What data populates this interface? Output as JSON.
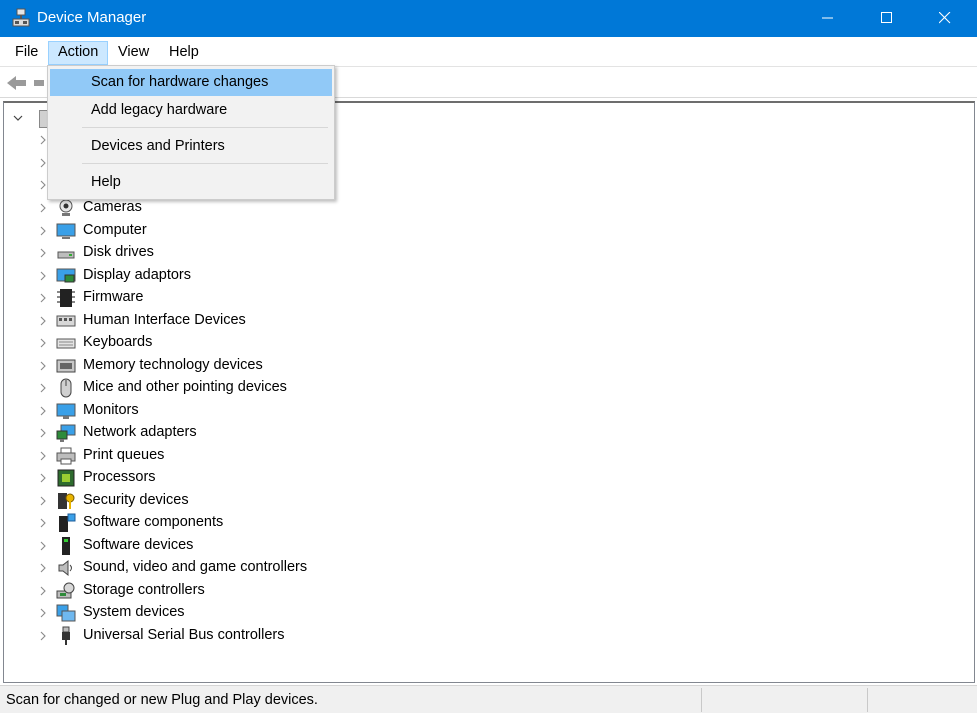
{
  "window": {
    "title": "Device Manager"
  },
  "menu": {
    "file": "File",
    "action": "Action",
    "view": "View",
    "help": "Help"
  },
  "action_menu": {
    "items": [
      {
        "label": "Scan for hardware changes",
        "highlighted": true
      },
      {
        "label": "Add legacy hardware"
      },
      {
        "label": "Devices and Printers"
      },
      {
        "label": "Help"
      }
    ]
  },
  "tree": {
    "categories": [
      {
        "label": "Cameras",
        "icon": "camera-icon"
      },
      {
        "label": "Computer",
        "icon": "computer-icon"
      },
      {
        "label": "Disk drives",
        "icon": "disk-drive-icon"
      },
      {
        "label": "Display adaptors",
        "icon": "display-adapter-icon"
      },
      {
        "label": "Firmware",
        "icon": "firmware-chip-icon"
      },
      {
        "label": "Human Interface Devices",
        "icon": "hid-icon"
      },
      {
        "label": "Keyboards",
        "icon": "keyboard-icon"
      },
      {
        "label": "Memory technology devices",
        "icon": "memory-device-icon"
      },
      {
        "label": "Mice and other pointing devices",
        "icon": "mouse-icon"
      },
      {
        "label": "Monitors",
        "icon": "monitor-icon"
      },
      {
        "label": "Network adapters",
        "icon": "network-adapter-icon"
      },
      {
        "label": "Print queues",
        "icon": "printer-icon"
      },
      {
        "label": "Processors",
        "icon": "processor-icon"
      },
      {
        "label": "Security devices",
        "icon": "security-device-icon"
      },
      {
        "label": "Software components",
        "icon": "software-component-icon"
      },
      {
        "label": "Software devices",
        "icon": "software-device-icon"
      },
      {
        "label": "Sound, video and game controllers",
        "icon": "speaker-icon"
      },
      {
        "label": "Storage controllers",
        "icon": "storage-controller-icon"
      },
      {
        "label": "System devices",
        "icon": "system-device-icon"
      },
      {
        "label": "Universal Serial Bus controllers",
        "icon": "usb-icon"
      }
    ]
  },
  "status": {
    "text": "Scan for changed or new Plug and Play devices."
  },
  "colors": {
    "titlebar": "#0078d7",
    "menu_highlight": "#91c9f7",
    "active_menu": "#cce8ff"
  }
}
